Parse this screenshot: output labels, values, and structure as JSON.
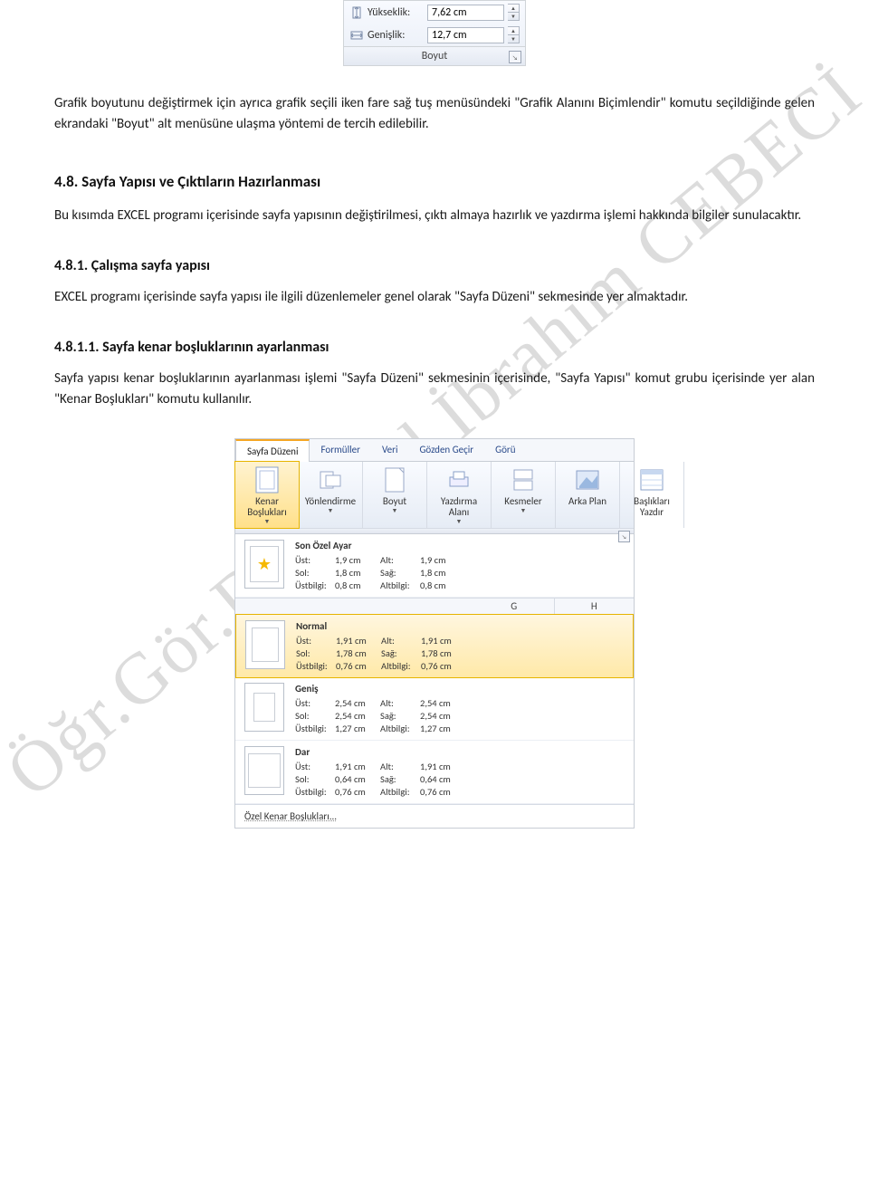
{
  "boyut_panel": {
    "height_label": "Yükseklik:",
    "height_value": "7,62 cm",
    "width_label": "Genişlik:",
    "width_value": "12,7 cm",
    "group_name": "Boyut"
  },
  "para1": "Grafik boyutunu değiştirmek için ayrıca grafik seçili iken fare sağ tuş menüsündeki \"Grafik Alanını Biçimlendir\" komutu seçildiğinde gelen ekrandaki \"Boyut\" alt menüsüne ulaşma yöntemi de tercih edilebilir.",
  "h48": "4.8. Sayfa Yapısı ve Çıktıların Hazırlanması",
  "para2": "Bu kısımda EXCEL programı içerisinde sayfa yapısının değiştirilmesi, çıktı almaya hazırlık ve yazdırma işlemi hakkında bilgiler sunulacaktır.",
  "h481": "4.8.1. Çalışma sayfa yapısı",
  "para3": "EXCEL programı içerisinde sayfa yapısı ile ilgili düzenlemeler genel olarak \"Sayfa Düzeni\" sekmesinde yer almaktadır.",
  "h4811": "4.8.1.1. Sayfa kenar boşluklarının ayarlanması",
  "para4": "Sayfa yapısı kenar boşluklarının ayarlanması işlemi \"Sayfa Düzeni\" sekmesinin içerisinde, \"Sayfa Yapısı\" komut grubu içerisinde yer alan \"Kenar Boşlukları\" komutu kullanılır.",
  "watermark": "Öğr.Gör.Dr. Halil İbrahim CEBECİ",
  "ribbon": {
    "tabs": [
      "Sayfa Düzeni",
      "Formüller",
      "Veri",
      "Gözden Geçir",
      "Görü"
    ],
    "buttons": {
      "margins": "Kenar Boşlukları",
      "orientation": "Yönlendirme",
      "size": "Boyut",
      "print_area": "Yazdırma Alanı",
      "breaks": "Kesmeler",
      "background": "Arka Plan",
      "print_titles": "Başlıkları Yazdır"
    },
    "cols": [
      "G",
      "H"
    ],
    "presets": [
      {
        "title": "Son Özel Ayar",
        "rows": [
          [
            "Üst:",
            "1,9 cm",
            "Alt:",
            "1,9 cm"
          ],
          [
            "Sol:",
            "1,8 cm",
            "Sağ:",
            "1,8 cm"
          ],
          [
            "Üstbilgi:",
            "0,8 cm",
            "Altbilgi:",
            "0,8 cm"
          ]
        ],
        "star": true
      },
      {
        "title": "Normal",
        "rows": [
          [
            "Üst:",
            "1,91 cm",
            "Alt:",
            "1,91 cm"
          ],
          [
            "Sol:",
            "1,78 cm",
            "Sağ:",
            "1,78 cm"
          ],
          [
            "Üstbilgi:",
            "0,76 cm",
            "Altbilgi:",
            "0,76 cm"
          ]
        ],
        "highlight": true
      },
      {
        "title": "Geniş",
        "rows": [
          [
            "Üst:",
            "2,54 cm",
            "Alt:",
            "2,54 cm"
          ],
          [
            "Sol:",
            "2,54 cm",
            "Sağ:",
            "2,54 cm"
          ],
          [
            "Üstbilgi:",
            "1,27 cm",
            "Altbilgi:",
            "1,27 cm"
          ]
        ]
      },
      {
        "title": "Dar",
        "rows": [
          [
            "Üst:",
            "1,91 cm",
            "Alt:",
            "1,91 cm"
          ],
          [
            "Sol:",
            "0,64 cm",
            "Sağ:",
            "0,64 cm"
          ],
          [
            "Üstbilgi:",
            "0,76 cm",
            "Altbilgi:",
            "0,76 cm"
          ]
        ]
      }
    ],
    "custom": "Özel Kenar Boşlukları..."
  }
}
